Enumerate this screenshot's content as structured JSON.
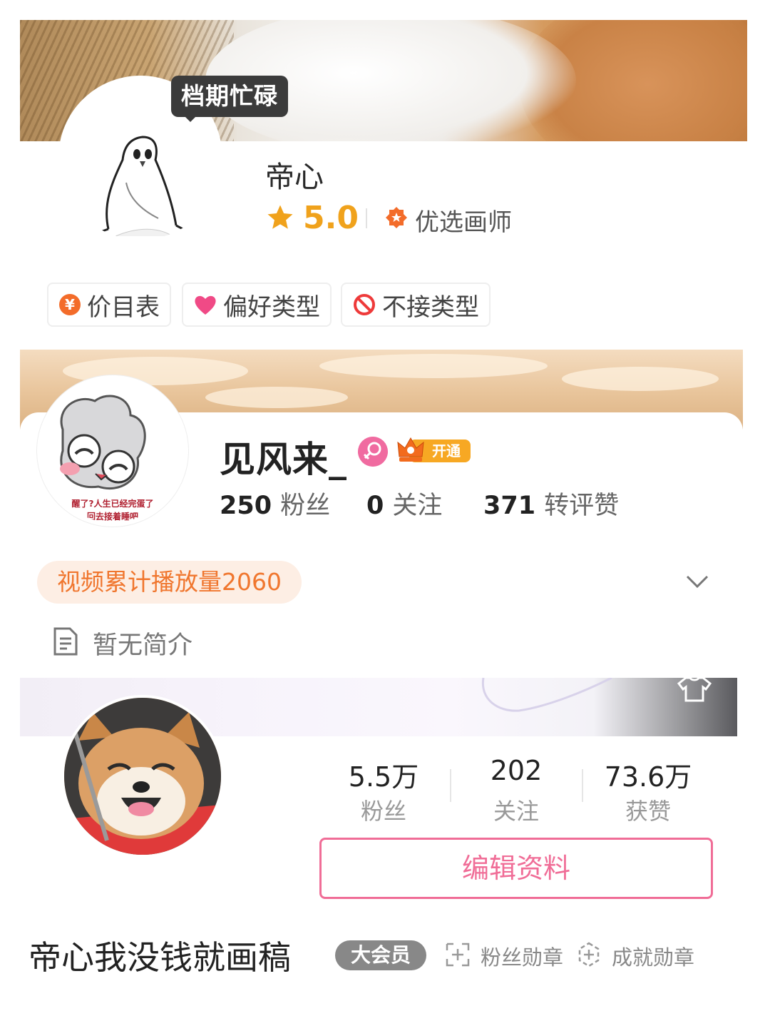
{
  "section1": {
    "status_tooltip": "档期忙碌",
    "name": "帝心",
    "rating": "5.0",
    "badge": "优选画师",
    "chips": [
      {
        "label": "价目表",
        "icon": "yen-coin-icon"
      },
      {
        "label": "偏好类型",
        "icon": "heart-icon"
      },
      {
        "label": "不接类型",
        "icon": "prohibited-icon"
      }
    ]
  },
  "section2": {
    "name": "见风来_",
    "vip_label": "开通",
    "stats": {
      "fans_value": "250",
      "fans_label": "粉丝",
      "following_value": "0",
      "following_label": "关注",
      "interactions_value": "371",
      "interactions_label": "转评赞"
    },
    "play_count": "视频累计播放量2060",
    "bio": "暂无简介"
  },
  "section3": {
    "stats": [
      {
        "value": "5.5万",
        "label": "粉丝"
      },
      {
        "value": "202",
        "label": "关注"
      },
      {
        "value": "73.6万",
        "label": "获赞"
      }
    ],
    "edit_button": "编辑资料",
    "name": "帝心我没钱就画稿",
    "vip_badge": "大会员",
    "fan_medal": "粉丝勋章",
    "achievement_medal": "成就勋章"
  },
  "colors": {
    "rating": "#f0a21c",
    "badge_orange": "#f36c2a",
    "playcount_text": "#f0762e",
    "playcount_bg": "#fdeee4",
    "edit_pink": "#f06d97"
  }
}
